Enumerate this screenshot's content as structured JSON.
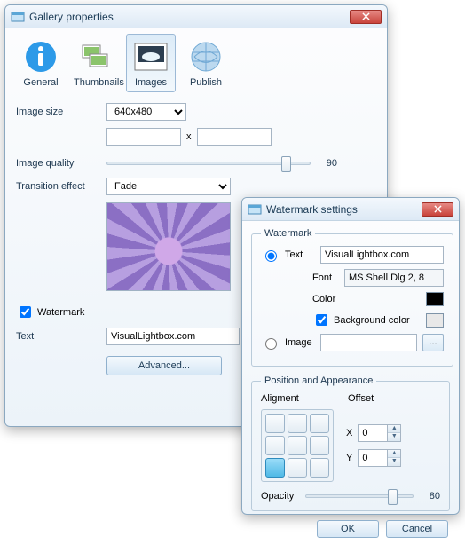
{
  "gallery": {
    "title": "Gallery properties",
    "tabs": {
      "general": "General",
      "thumbnails": "Thumbnails",
      "images": "Images",
      "publish": "Publish"
    },
    "image_size_label": "Image size",
    "image_size_value": "640x480",
    "dim_sep": "x",
    "quality_label": "Image quality",
    "quality_value": "90",
    "transition_label": "Transition effect",
    "transition_value": "Fade",
    "watermark_chk": "Watermark",
    "text_label": "Text",
    "text_value": "VisualLightbox.com",
    "advanced_btn": "Advanced..."
  },
  "wm": {
    "title": "Watermark settings",
    "group": "Watermark",
    "text_radio": "Text",
    "text_value": "VisualLightbox.com",
    "font_label": "Font",
    "font_value": "MS Shell Dlg 2, 8",
    "color_label": "Color",
    "bgcolor_label": "Background color",
    "image_radio": "Image",
    "browse": "...",
    "pos_group": "Position and Appearance",
    "align_label": "Aligment",
    "offset_label": "Offset",
    "x_label": "X",
    "x_value": "0",
    "y_label": "Y",
    "y_value": "0",
    "opacity_label": "Opacity",
    "opacity_value": "80",
    "ok": "OK",
    "cancel": "Cancel"
  }
}
